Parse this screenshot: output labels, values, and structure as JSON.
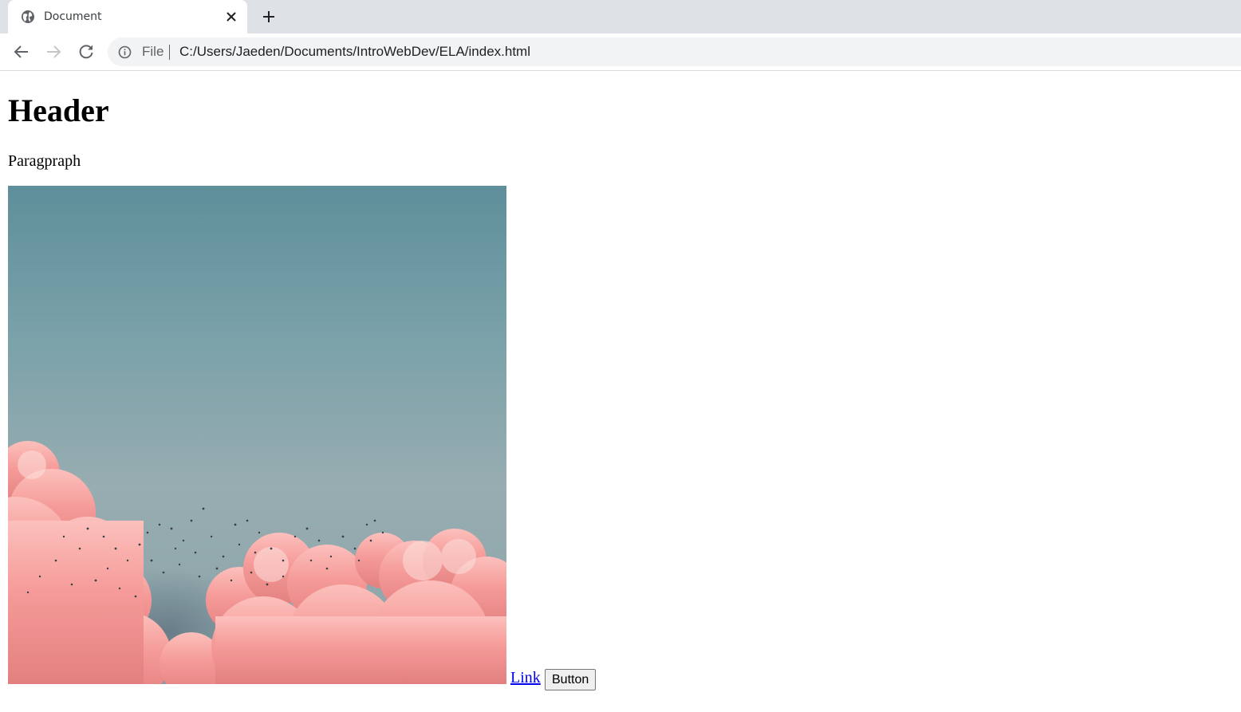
{
  "browser": {
    "tab": {
      "title": "Document",
      "icon": "globe-icon",
      "close_icon": "close-icon"
    },
    "new_tab_icon": "plus-icon",
    "nav": {
      "back_icon": "arrow-left-icon",
      "forward_icon": "arrow-right-icon",
      "reload_icon": "reload-icon"
    },
    "address_bar": {
      "info_icon": "info-icon",
      "scheme_label": "File",
      "url": "C:/Users/Jaeden/Documents/IntroWebDev/ELA/index.html"
    }
  },
  "page": {
    "heading": "Header",
    "paragraph": "Paragpraph",
    "image": {
      "subject": "pink clouds and flock of birds against teal sky"
    },
    "link_text": "Link",
    "button_label": "Button"
  },
  "colors": {
    "tabstrip": "#dee1e6",
    "omnibox": "#f1f3f4",
    "link": "#0000ee",
    "sky_top": "#5f909b",
    "cloud": "#f49a9a"
  }
}
